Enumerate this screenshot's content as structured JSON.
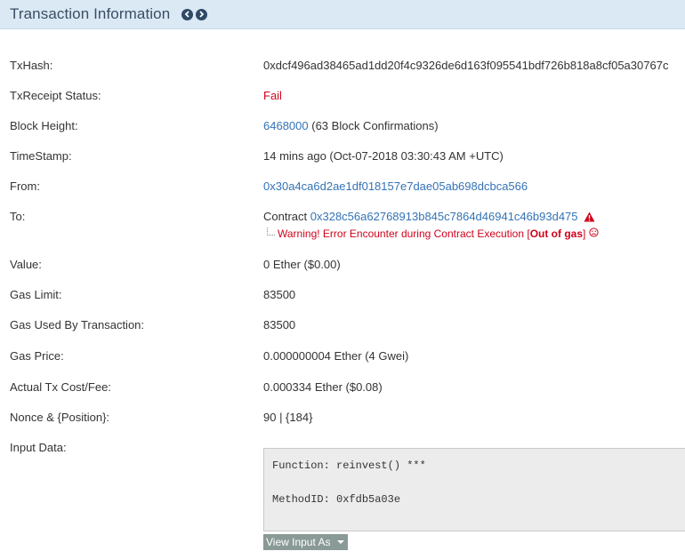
{
  "header": {
    "title": "Transaction Information"
  },
  "fields": {
    "txhash": {
      "label": "TxHash:",
      "value": "0xdcf496ad38465ad1dd20f4c9326de6d163f095541bdf726b818a8cf05a30767c"
    },
    "status": {
      "label": "TxReceipt Status:",
      "value": "Fail"
    },
    "block": {
      "label": "Block Height:",
      "value": "6468000",
      "confirmations": "(63 Block Confirmations)"
    },
    "timestamp": {
      "label": "TimeStamp:",
      "value": "14 mins ago (Oct-07-2018 03:30:43 AM +UTC)"
    },
    "from": {
      "label": "From:",
      "value": "0x30a4ca6d2ae1df018157e7dae05ab698dcbca566"
    },
    "to": {
      "label": "To:",
      "prefix": "Contract",
      "value": "0x328c56a62768913b845c7864d46941c46b93d475",
      "warning_text": "Warning! Error Encounter during Contract Execution [",
      "warning_bold": "Out of gas",
      "warning_suffix": "]"
    },
    "value": {
      "label": "Value:",
      "value": "0 Ether ($0.00)"
    },
    "gas_limit": {
      "label": "Gas Limit:",
      "value": "83500"
    },
    "gas_used": {
      "label": "Gas Used By Transaction:",
      "value": "83500"
    },
    "gas_price": {
      "label": "Gas Price:",
      "value": "0.000000004 Ether (4 Gwei)"
    },
    "tx_fee": {
      "label": "Actual Tx Cost/Fee:",
      "value": "0.000334 Ether ($0.08)"
    },
    "nonce": {
      "label": "Nonce & {Position}:",
      "value": "90 | {184}"
    },
    "input": {
      "label": "Input Data:",
      "function_line": "Function: reinvest() ***",
      "method_line": "MethodID: 0xfdb5a03e",
      "view_button": "View Input As"
    }
  },
  "colors": {
    "header_bg": "#dbe9f4",
    "link": "#3473b6",
    "error": "#d0021b"
  },
  "icons": [
    "chevron-left-icon",
    "chevron-right-icon",
    "warning-triangle-icon",
    "sad-face-icon",
    "caret-down-icon"
  ]
}
